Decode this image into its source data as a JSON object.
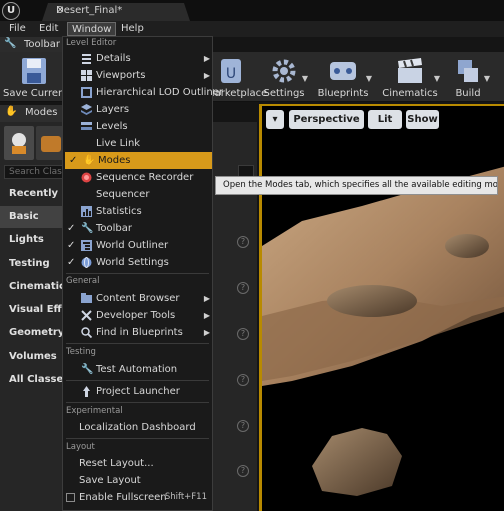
{
  "document_tab": {
    "title": "Desert_Final*"
  },
  "menubar": {
    "file": "File",
    "edit": "Edit",
    "window": "Window",
    "help": "Help"
  },
  "toolbar_tab": {
    "label": "Toolbar"
  },
  "toolbar": {
    "save_label": "Save Current",
    "marketplace_label": "Marketplace",
    "settings_label": "Settings",
    "blueprints_label": "Blueprints",
    "cinematics_label": "Cinematics",
    "build_label": "Build"
  },
  "modes_tab": {
    "label": "Modes"
  },
  "modes_panel": {
    "search_placeholder": "Search Classes",
    "categories": [
      "Recently Placed",
      "Basic",
      "Lights",
      "Testing",
      "Cinematic",
      "Visual Effects",
      "Geometry",
      "Volumes",
      "All Classes"
    ],
    "selected_category": "Basic"
  },
  "viewport": {
    "perspective": "Perspective",
    "lit": "Lit",
    "show": "Show"
  },
  "window_menu": {
    "level_editor_header": "Level Editor",
    "items": [
      {
        "label": "Details",
        "submenu": true,
        "checked": false
      },
      {
        "label": "Viewports",
        "submenu": true,
        "checked": false
      },
      {
        "label": "Hierarchical LOD Outliner",
        "submenu": false,
        "checked": false
      },
      {
        "label": "Layers",
        "submenu": false,
        "checked": false
      },
      {
        "label": "Levels",
        "submenu": false,
        "checked": false
      },
      {
        "label": "Live Link",
        "submenu": false,
        "checked": false
      },
      {
        "label": "Modes",
        "submenu": false,
        "checked": true,
        "highlighted": true
      },
      {
        "label": "Sequence Recorder",
        "submenu": false,
        "checked": false
      },
      {
        "label": "Sequencer",
        "submenu": false,
        "checked": false
      },
      {
        "label": "Statistics",
        "submenu": false,
        "checked": false
      },
      {
        "label": "Toolbar",
        "submenu": false,
        "checked": true
      },
      {
        "label": "World Outliner",
        "submenu": false,
        "checked": true
      },
      {
        "label": "World Settings",
        "submenu": false,
        "checked": true
      }
    ],
    "general_header": "General",
    "general_items": [
      {
        "label": "Content Browser",
        "submenu": true
      },
      {
        "label": "Developer Tools",
        "submenu": true
      },
      {
        "label": "Find in Blueprints",
        "submenu": true
      }
    ],
    "testing_header": "Testing",
    "testing_items": [
      {
        "label": "Test Automation"
      }
    ],
    "project_launcher": "Project Launcher",
    "experimental_header": "Experimental",
    "experimental_items": [
      {
        "label": "Localization Dashboard"
      }
    ],
    "layout_header": "Layout",
    "layout_items": [
      {
        "label": "Reset Layout..."
      },
      {
        "label": "Save Layout"
      },
      {
        "label": "Enable Fullscreen",
        "shortcut": "Shift+F11"
      }
    ]
  },
  "tooltip": {
    "text": "Open the Modes tab, which specifies all the available editing modes."
  },
  "colors": {
    "accent": "#d89a1a",
    "viewport_border": "#b88a00"
  }
}
